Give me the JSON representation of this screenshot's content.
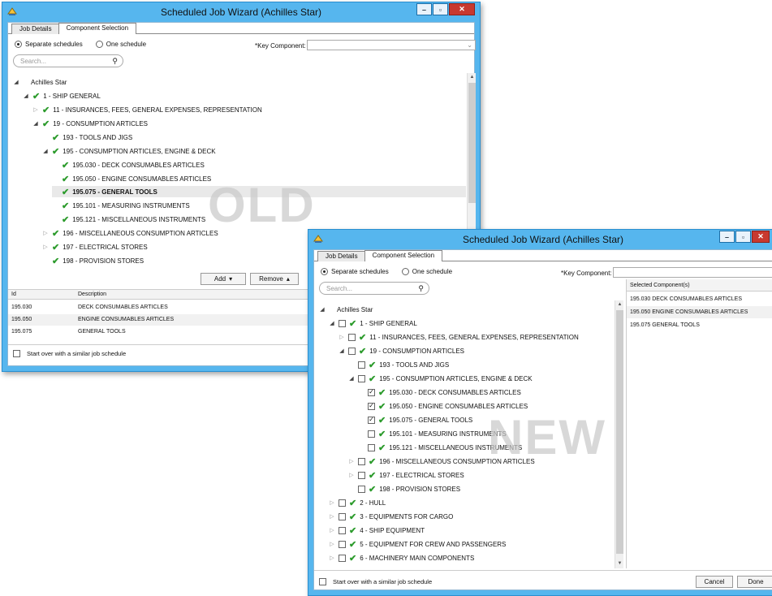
{
  "old_window": {
    "title": "Scheduled Job Wizard (Achilles Star)",
    "tabs": [
      "Job Details",
      "Component Selection"
    ],
    "radio_separate": "Separate schedules",
    "radio_one": "One schedule",
    "key_component_label": "*Key Component:",
    "search_placeholder": "Search...",
    "tree": [
      {
        "label": "Achilles Star"
      },
      {
        "label": "1 - SHIP GENERAL"
      },
      {
        "label": "11 - INSURANCES, FEES, GENERAL EXPENSES, REPRESENTATION"
      },
      {
        "label": "19 - CONSUMPTION ARTICLES"
      },
      {
        "label": "193 - TOOLS AND JIGS"
      },
      {
        "label": "195 - CONSUMPTION ARTICLES, ENGINE & DECK"
      },
      {
        "label": "195.030 - DECK CONSUMABLES ARTICLES"
      },
      {
        "label": "195.050 - ENGINE CONSUMABLES ARTICLES"
      },
      {
        "label": "195.075 - GENERAL TOOLS"
      },
      {
        "label": "195.101 - MEASURING INSTRUMENTS"
      },
      {
        "label": "195.121 - MISCELLANEOUS INSTRUMENTS"
      },
      {
        "label": "196 - MISCELLANEOUS CONSUMPTION ARTICLES"
      },
      {
        "label": "197 - ELECTRICAL STORES"
      },
      {
        "label": "198 - PROVISION STORES"
      }
    ],
    "add_label": "Add",
    "remove_label": "Remove",
    "grid_headers": {
      "id": "Id",
      "description": "Description"
    },
    "grid_rows": [
      {
        "id": "195.030",
        "description": "DECK CONSUMABLES ARTICLES"
      },
      {
        "id": "195.050",
        "description": "ENGINE CONSUMABLES ARTICLES"
      },
      {
        "id": "195.075",
        "description": "GENERAL TOOLS"
      }
    ],
    "start_over": "Start over with a similar job schedule",
    "watermark": "OLD"
  },
  "new_window": {
    "title": "Scheduled Job Wizard (Achilles Star)",
    "tabs": [
      "Job Details",
      "Component Selection"
    ],
    "radio_separate": "Separate schedules",
    "radio_one": "One schedule",
    "key_component_label": "*Key Component:",
    "search_placeholder": "Search...",
    "tree": [
      {
        "label": "Achilles Star"
      },
      {
        "label": "1 - SHIP GENERAL"
      },
      {
        "label": "11 - INSURANCES, FEES, GENERAL EXPENSES, REPRESENTATION"
      },
      {
        "label": "19 - CONSUMPTION ARTICLES"
      },
      {
        "label": "193 - TOOLS AND JIGS"
      },
      {
        "label": "195 - CONSUMPTION ARTICLES, ENGINE & DECK"
      },
      {
        "label": "195.030 - DECK CONSUMABLES ARTICLES"
      },
      {
        "label": "195.050 - ENGINE CONSUMABLES ARTICLES"
      },
      {
        "label": "195.075 - GENERAL TOOLS"
      },
      {
        "label": "195.101 - MEASURING INSTRUMENTS"
      },
      {
        "label": "195.121 - MISCELLANEOUS INSTRUMENTS"
      },
      {
        "label": "196 - MISCELLANEOUS CONSUMPTION ARTICLES"
      },
      {
        "label": "197 - ELECTRICAL STORES"
      },
      {
        "label": "198 - PROVISION STORES"
      },
      {
        "label": "2 - HULL"
      },
      {
        "label": "3 - EQUIPMENTS FOR CARGO"
      },
      {
        "label": "4 - SHIP EQUIPMENT"
      },
      {
        "label": "5 - EQUIPMENT FOR CREW AND PASSENGERS"
      },
      {
        "label": "6 - MACHINERY MAIN COMPONENTS"
      }
    ],
    "selected_header": "Selected Component(s)",
    "selected_items": [
      "195.030 DECK CONSUMABLES ARTICLES",
      "195.050 ENGINE CONSUMABLES ARTICLES",
      "195.075 GENERAL TOOLS"
    ],
    "start_over": "Start over with a similar job schedule",
    "cancel_label": "Cancel",
    "done_label": "Done",
    "watermark": "NEW"
  },
  "icons": {
    "checkmark": "check-icon",
    "expand_open": "triangle-down-icon",
    "expand_closed": "triangle-right-icon",
    "search": "magnifier-icon"
  },
  "colors": {
    "title_bar": "#56b6ee",
    "close_button": "#c8392f",
    "checkmark": "#2c9b2c"
  }
}
